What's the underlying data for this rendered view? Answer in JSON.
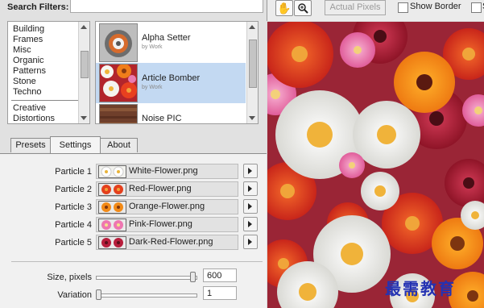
{
  "filters": {
    "label": "Search Filters:",
    "value": ""
  },
  "categories": [
    "Building",
    "Frames",
    "Misc",
    "Organic",
    "Patterns",
    "Stone",
    "Techno",
    "Creative",
    "Distortions"
  ],
  "presets": [
    {
      "name": "Alpha Setter",
      "author": "by Work"
    },
    {
      "name": "Article Bomber",
      "author": "by Work"
    },
    {
      "name": "Noise PIC",
      "author": ""
    }
  ],
  "tabs": [
    "Presets",
    "Settings",
    "About"
  ],
  "particles": [
    {
      "label": "Particle 1",
      "file": "White-Flower.png"
    },
    {
      "label": "Particle 2",
      "file": "Red-Flower.png"
    },
    {
      "label": "Particle 3",
      "file": "Orange-Flower.png"
    },
    {
      "label": "Particle 4",
      "file": "Pink-Flower.png"
    },
    {
      "label": "Particle 5",
      "file": "Dark-Red-Flower.png"
    }
  ],
  "size": {
    "label": "Size, pixels",
    "value": "600"
  },
  "variation": {
    "label": "Variation",
    "value": "1"
  },
  "toolbar": {
    "actual_pixels": "Actual Pixels",
    "show_border": "Show Border",
    "cut_label": "S"
  },
  "icons": {
    "hand": "hand-tool-icon",
    "zoom": "zoom-tool-icon",
    "arrow": "play-arrow-icon"
  },
  "watermark": "最需教育"
}
